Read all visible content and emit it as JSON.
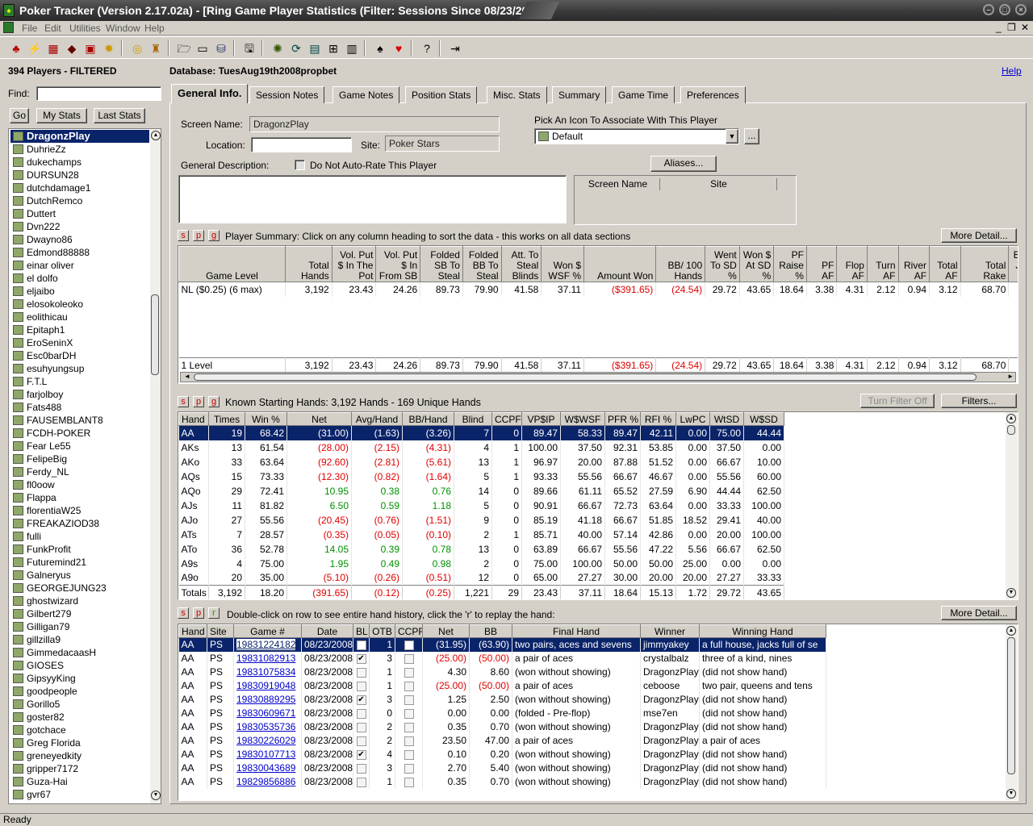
{
  "window": {
    "title": "Poker Tracker (Version 2.17.02a) - [Ring Game Player Statistics (Filter: Sessions Since 08/23/2008)]"
  },
  "menu": [
    "File",
    "Edit",
    "Utilities",
    "Window",
    "Help"
  ],
  "status": "Ready",
  "left": {
    "count": "394 Players - FILTERED",
    "find_label": "Find:",
    "go": "Go",
    "my_stats": "My Stats",
    "last_stats": "Last Stats",
    "players": [
      "DragonzPlay",
      "DuhrieZz",
      "dukechamps",
      "DURSUN28",
      "dutchdamage1",
      "DutchRemco",
      "Duttert",
      "Dvn222",
      "Dwayno86",
      "Edmond88888",
      "einar oliver",
      "el dolfo",
      "eljaibo",
      "elosokoleoko",
      "eolithicau",
      "Epitaph1",
      "EroSeninX",
      "Esc0barDH",
      "esuhyungsup",
      "F.T.L",
      "farjolboy",
      "Fats488",
      "FAUSEMBLANT8",
      "FCDH-POKER",
      "Fear Le55",
      "FelipeBig",
      "Ferdy_NL",
      "fl0oow",
      "Flappa",
      "florentiaW25",
      "FREAKAZIOD38",
      "fulli",
      "FunkProfit",
      "Futuremind21",
      "Galneryus",
      "GEORGEJUNG23",
      "ghostwizard",
      "Gilbert279",
      "Gilligan79",
      "gillzilla9",
      "GimmedacaasH",
      "GIOSES",
      "GipsyyKing",
      "goodpeople",
      "Gorillo5",
      "goster82",
      "gotchace",
      "Greg Florida",
      "greneyedkity",
      "gripper7172",
      "Guza-Hai",
      "gvr67"
    ]
  },
  "header": {
    "database": "Database: TuesAug19th2008propbet",
    "help": "Help"
  },
  "tabs": [
    "General Info.",
    "Session Notes",
    "Game Notes",
    "Position Stats",
    "Misc. Stats",
    "Summary",
    "Game Time",
    "Preferences"
  ],
  "general": {
    "screen_name_label": "Screen Name:",
    "screen_name": "DragonzPlay",
    "location_label": "Location:",
    "site_label": "Site:",
    "site": "Poker Stars",
    "icon_label": "Pick An Icon To Associate With This Player",
    "icon_value": "Default",
    "ellipsis": "...",
    "desc_label": "General Description:",
    "no_autorate": "Do Not Auto-Rate This Player",
    "aliases": "Aliases...",
    "alias_cols": [
      "Screen Name",
      "Site"
    ]
  },
  "summary": {
    "s": "s",
    "p": "p",
    "g": "g",
    "title": "Player Summary: Click on any column heading to sort the data - this works on all data sections",
    "more": "More Detail...",
    "cols": [
      "Game Level",
      "Total Hands",
      "Vol. Put $ In The Pot",
      "Vol. Put $ In From SB",
      "Folded SB To Steal",
      "Folded BB To Steal",
      "Att. To Steal Blinds",
      "Won $ WSF %",
      "Amount Won",
      "BB/ 100 Hands",
      "Went To SD %",
      "Won $ At SD %",
      "PF Raise %",
      "PF AF",
      "Flop AF",
      "Turn AF",
      "River AF",
      "Total AF",
      "Total Rake",
      "Bad Jac Co"
    ],
    "row": [
      "NL ($0.25) (6 max)",
      "3,192",
      "23.43",
      "24.26",
      "89.73",
      "79.90",
      "41.58",
      "37.11",
      "($391.65)",
      "(24.54)",
      "29.72",
      "43.65",
      "18.64",
      "3.38",
      "4.31",
      "2.12",
      "0.94",
      "3.12",
      "68.70",
      ""
    ],
    "total": [
      "1 Level",
      "3,192",
      "23.43",
      "24.26",
      "89.73",
      "79.90",
      "41.58",
      "37.11",
      "($391.65)",
      "(24.54)",
      "29.72",
      "43.65",
      "18.64",
      "3.38",
      "4.31",
      "2.12",
      "0.94",
      "3.12",
      "68.70",
      ""
    ]
  },
  "hands": {
    "s": "s",
    "p": "p",
    "g": "g",
    "title": "Known Starting Hands: 3,192 Hands - 169 Unique Hands",
    "turn_filter": "Turn Filter Off",
    "filters": "Filters...",
    "cols": [
      "Hand",
      "Times",
      "Win %",
      "Net",
      "Avg/Hand",
      "BB/Hand",
      "Blind",
      "CCPF",
      "VP$IP",
      "W$WSF",
      "PFR %",
      "RFI %",
      "LwPC",
      "WtSD",
      "W$SD"
    ],
    "rows": [
      [
        "AA",
        "19",
        "68.42",
        "(31.00)",
        "(1.63)",
        "(3.26)",
        "7",
        "0",
        "89.47",
        "58.33",
        "89.47",
        "42.11",
        "0.00",
        "75.00",
        "44.44"
      ],
      [
        "AKs",
        "13",
        "61.54",
        "(28.00)",
        "(2.15)",
        "(4.31)",
        "4",
        "1",
        "100.00",
        "37.50",
        "92.31",
        "53.85",
        "0.00",
        "37.50",
        "0.00"
      ],
      [
        "AKo",
        "33",
        "63.64",
        "(92.60)",
        "(2.81)",
        "(5.61)",
        "13",
        "1",
        "96.97",
        "20.00",
        "87.88",
        "51.52",
        "0.00",
        "66.67",
        "10.00"
      ],
      [
        "AQs",
        "15",
        "73.33",
        "(12.30)",
        "(0.82)",
        "(1.64)",
        "5",
        "1",
        "93.33",
        "55.56",
        "66.67",
        "46.67",
        "0.00",
        "55.56",
        "60.00"
      ],
      [
        "AQo",
        "29",
        "72.41",
        "10.95",
        "0.38",
        "0.76",
        "14",
        "0",
        "89.66",
        "61.11",
        "65.52",
        "27.59",
        "6.90",
        "44.44",
        "62.50"
      ],
      [
        "AJs",
        "11",
        "81.82",
        "6.50",
        "0.59",
        "1.18",
        "5",
        "0",
        "90.91",
        "66.67",
        "72.73",
        "63.64",
        "0.00",
        "33.33",
        "100.00"
      ],
      [
        "AJo",
        "27",
        "55.56",
        "(20.45)",
        "(0.76)",
        "(1.51)",
        "9",
        "0",
        "85.19",
        "41.18",
        "66.67",
        "51.85",
        "18.52",
        "29.41",
        "40.00"
      ],
      [
        "ATs",
        "7",
        "28.57",
        "(0.35)",
        "(0.05)",
        "(0.10)",
        "2",
        "1",
        "85.71",
        "40.00",
        "57.14",
        "42.86",
        "0.00",
        "20.00",
        "100.00"
      ],
      [
        "ATo",
        "36",
        "52.78",
        "14.05",
        "0.39",
        "0.78",
        "13",
        "0",
        "63.89",
        "66.67",
        "55.56",
        "47.22",
        "5.56",
        "66.67",
        "62.50"
      ],
      [
        "A9s",
        "4",
        "75.00",
        "1.95",
        "0.49",
        "0.98",
        "2",
        "0",
        "75.00",
        "100.00",
        "50.00",
        "50.00",
        "25.00",
        "0.00",
        "0.00"
      ],
      [
        "A9o",
        "20",
        "35.00",
        "(5.10)",
        "(0.26)",
        "(0.51)",
        "12",
        "0",
        "65.00",
        "27.27",
        "30.00",
        "20.00",
        "20.00",
        "27.27",
        "33.33"
      ]
    ],
    "total": [
      "Totals",
      "3,192",
      "18.20",
      "(391.65)",
      "(0.12)",
      "(0.25)",
      "1,221",
      "29",
      "23.43",
      "37.11",
      "18.64",
      "15.13",
      "1.72",
      "29.72",
      "43.65"
    ]
  },
  "history": {
    "s": "s",
    "p": "p",
    "r": "r",
    "title": "Double-click on row to see entire hand history, click the 'r' to replay the hand:",
    "more": "More Detail...",
    "cols": [
      "Hand",
      "Site",
      "Game #",
      "Date",
      "BL",
      "OTB",
      "CCPF",
      "Net",
      "BB",
      "Final Hand",
      "Winner",
      "Winning Hand"
    ],
    "rows": [
      [
        "AA",
        "PS",
        "19831224182",
        "08/23/2008",
        "",
        "1",
        "",
        "(31.95)",
        "(63.90)",
        "two pairs, aces and sevens",
        "jimmyakey",
        "a full house, jacks full of se"
      ],
      [
        "AA",
        "PS",
        "19831082913",
        "08/23/2008",
        "✔",
        "3",
        "",
        "(25.00)",
        "(50.00)",
        "a pair of aces",
        "crystalbalz",
        "three of a kind, nines"
      ],
      [
        "AA",
        "PS",
        "19831075834",
        "08/23/2008",
        "",
        "1",
        "",
        "4.30",
        "8.60",
        "(won without showing)",
        "DragonzPlay",
        "(did not show hand)"
      ],
      [
        "AA",
        "PS",
        "19830919048",
        "08/23/2008",
        "",
        "1",
        "",
        "(25.00)",
        "(50.00)",
        "a pair of aces",
        "ceboose",
        "two pair, queens and tens"
      ],
      [
        "AA",
        "PS",
        "19830889295",
        "08/23/2008",
        "✔",
        "3",
        "",
        "1.25",
        "2.50",
        "(won without showing)",
        "DragonzPlay",
        "(did not show hand)"
      ],
      [
        "AA",
        "PS",
        "19830609671",
        "08/23/2008",
        "",
        "0",
        "",
        "0.00",
        "0.00",
        "(folded - Pre-flop)",
        "mse7en",
        "(did not show hand)"
      ],
      [
        "AA",
        "PS",
        "19830535736",
        "08/23/2008",
        "",
        "2",
        "",
        "0.35",
        "0.70",
        "(won without showing)",
        "DragonzPlay",
        "(did not show hand)"
      ],
      [
        "AA",
        "PS",
        "19830226029",
        "08/23/2008",
        "",
        "2",
        "",
        "23.50",
        "47.00",
        "a pair of aces",
        "DragonzPlay",
        "a pair of aces"
      ],
      [
        "AA",
        "PS",
        "19830107713",
        "08/23/2008",
        "✔",
        "4",
        "",
        "0.10",
        "0.20",
        "(won without showing)",
        "DragonzPlay",
        "(did not show hand)"
      ],
      [
        "AA",
        "PS",
        "19830043689",
        "08/23/2008",
        "",
        "3",
        "",
        "2.70",
        "5.40",
        "(won without showing)",
        "DragonzPlay",
        "(did not show hand)"
      ],
      [
        "AA",
        "PS",
        "19829856886",
        "08/23/2008",
        "",
        "1",
        "",
        "0.35",
        "0.70",
        "(won without showing)",
        "DragonzPlay",
        "(did not show hand)"
      ]
    ]
  }
}
